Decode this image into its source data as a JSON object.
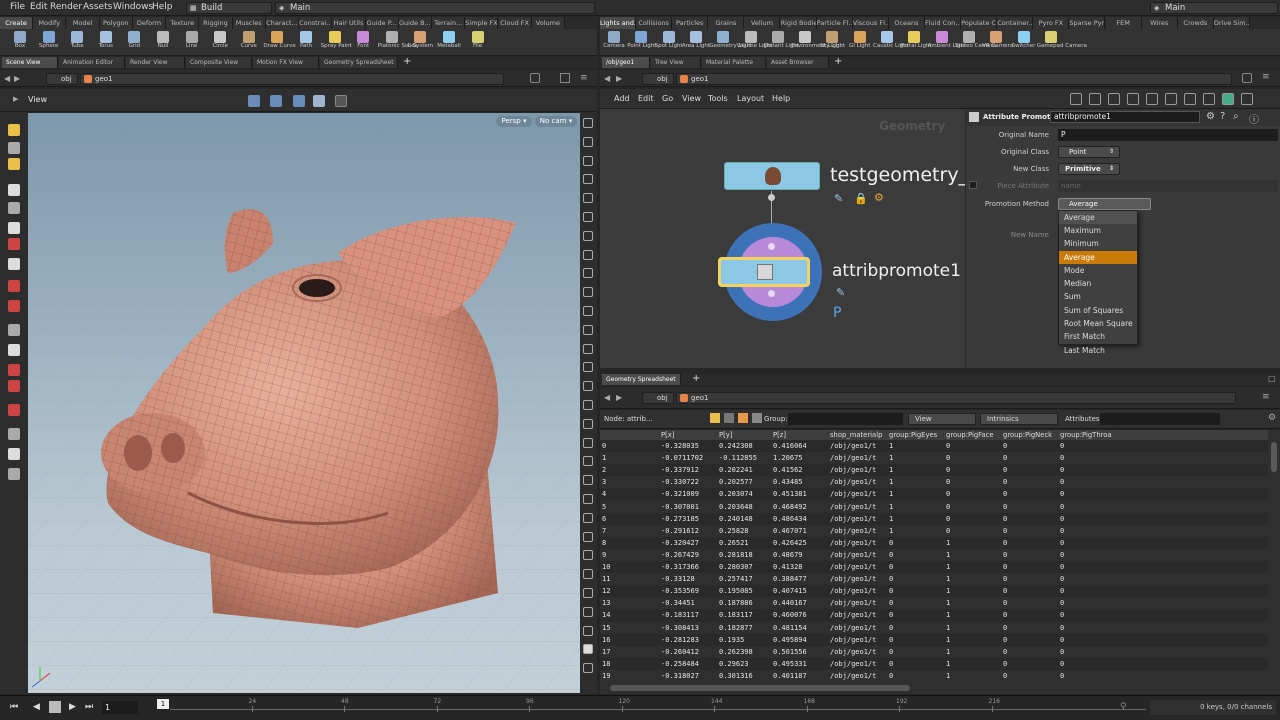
{
  "menubar": {
    "items": [
      "File",
      "Edit",
      "Render",
      "Assets",
      "Windows",
      "Help"
    ],
    "desktop": "Build",
    "scene": "Main",
    "right_desktop": "Main"
  },
  "left_shelf_tabs": [
    "Create",
    "Modify",
    "Model",
    "Polygon",
    "Deform",
    "Texture",
    "Rigging",
    "Muscles",
    "Charact...",
    "Constrai...",
    "Hair Utils",
    "Guide P...",
    "Guide B...",
    "Terrain...",
    "Simple FX",
    "Cloud FX",
    "Volume"
  ],
  "left_tools": [
    "Box",
    "Sphere",
    "Tube",
    "Torus",
    "Grid",
    "Null",
    "Line",
    "Circle",
    "Curve",
    "Draw Curve",
    "Path",
    "Spray Paint",
    "Font",
    "Platonic Solids",
    "L-System",
    "Metaball",
    "File"
  ],
  "right_shelf_tabs": [
    "Lights and...",
    "Collisions",
    "Particles",
    "Grains",
    "Vellum",
    "Rigid Bodies",
    "Particle Fl...",
    "Viscous Fl...",
    "Oceans",
    "Fluid Con...",
    "Populate C...",
    "Container...",
    "Pyro FX",
    "Sparse Pyr...",
    "FEM",
    "Wires",
    "Crowds",
    "Drive Sim..."
  ],
  "right_tools": [
    "Camera",
    "Point Light",
    "Spot Light",
    "Area Light",
    "Geometry Light",
    "Volume Light",
    "Distant Light",
    "Environment Light",
    "Sky Light",
    "GI Light",
    "Caustic Light",
    "Portal Light",
    "Ambient Light",
    "Stereo Camera",
    "VR Camera",
    "Switcher",
    "Gamepad Camera"
  ],
  "left_pane_tabs": [
    "Scene View",
    "Animation Editor",
    "Render View",
    "Composite View",
    "Motion FX View",
    "Geometry Spreadsheet"
  ],
  "viewport": {
    "path_obj": "obj",
    "path_geo": "geo1",
    "view_label": "View",
    "persp": "Persp",
    "cam": "No cam"
  },
  "network": {
    "tabs": [
      "/obj/geo1",
      "Tree View",
      "Material Palette",
      "Asset Browser"
    ],
    "path_obj": "obj",
    "path_geo": "geo1",
    "menu": [
      "Add",
      "Edit",
      "Go",
      "View",
      "Tools",
      "Layout",
      "Help"
    ],
    "context_label": "Geometry",
    "node1_name": "testgeometry_p",
    "node2_name": "attribpromote1",
    "node2_flag": "P"
  },
  "parms": {
    "type": "Attribute Promote",
    "node_name": "attribpromote1",
    "original_name_label": "Original Name",
    "original_name_value": "P",
    "original_class_label": "Original Class",
    "original_class_value": "Point",
    "new_class_label": "New Class",
    "new_class_value": "Primitive",
    "piece_attr_label": "Piece Attribute",
    "piece_attr_value": "name",
    "promo_method_label": "Promotion Method",
    "promo_method_value": "Average",
    "new_name_label": "New Name",
    "menu_options": [
      "Maximum",
      "Minimum",
      "Average",
      "Mode",
      "Median",
      "Sum",
      "Sum of Squares",
      "Root Mean Square",
      "First Match",
      "Last Match"
    ],
    "menu_selected": "Average"
  },
  "spreadsheet": {
    "tab": "Geometry Spreadsheet",
    "path_obj": "obj",
    "path_geo": "geo1",
    "node_label": "Node: attrib...",
    "group_label": "Group:",
    "view_label": "View",
    "intrinsics_label": "Intrinsics",
    "attributes_label": "Attributes:",
    "columns": [
      "",
      "P[x]",
      "P[y]",
      "P[z]",
      "shop_materialp",
      "group:PigEyes",
      "group:PigFace",
      "group:PigNeck",
      "group:PigThroa"
    ],
    "rows": [
      [
        "0",
        "-0.328035",
        "0.242308",
        "0.416064",
        "/obj/geo1/t",
        "1",
        "0",
        "0",
        "0"
      ],
      [
        "1",
        "-0.0711702",
        "-0.112855",
        "1.20675",
        "/obj/geo1/t",
        "1",
        "0",
        "0",
        "0"
      ],
      [
        "2",
        "-0.337912",
        "0.202241",
        "0.41562",
        "/obj/geo1/t",
        "1",
        "0",
        "0",
        "0"
      ],
      [
        "3",
        "-0.330722",
        "0.202577",
        "0.43485",
        "/obj/geo1/t",
        "1",
        "0",
        "0",
        "0"
      ],
      [
        "4",
        "-0.321009",
        "0.203074",
        "0.451381",
        "/obj/geo1/t",
        "1",
        "0",
        "0",
        "0"
      ],
      [
        "5",
        "-0.307001",
        "0.203648",
        "0.468492",
        "/obj/geo1/t",
        "1",
        "0",
        "0",
        "0"
      ],
      [
        "6",
        "-0.273185",
        "0.240148",
        "0.486434",
        "/obj/geo1/t",
        "1",
        "0",
        "0",
        "0"
      ],
      [
        "7",
        "-0.291612",
        "0.25828",
        "0.467071",
        "/obj/geo1/t",
        "1",
        "0",
        "0",
        "0"
      ],
      [
        "8",
        "-0.320427",
        "0.26521",
        "0.426425",
        "/obj/geo1/t",
        "0",
        "1",
        "0",
        "0"
      ],
      [
        "9",
        "-0.267429",
        "0.281818",
        "0.48679",
        "/obj/geo1/t",
        "0",
        "1",
        "0",
        "0"
      ],
      [
        "10",
        "-0.317366",
        "0.280307",
        "0.41328",
        "/obj/geo1/t",
        "0",
        "1",
        "0",
        "0"
      ],
      [
        "11",
        "-0.33128",
        "0.257417",
        "0.388477",
        "/obj/geo1/t",
        "0",
        "1",
        "0",
        "0"
      ],
      [
        "12",
        "-0.353569",
        "0.195085",
        "0.407415",
        "/obj/geo1/t",
        "0",
        "1",
        "0",
        "0"
      ],
      [
        "13",
        "-0.34451",
        "0.187886",
        "0.440167",
        "/obj/geo1/t",
        "0",
        "1",
        "0",
        "0"
      ],
      [
        "14",
        "-0.183117",
        "0.183117",
        "0.460076",
        "/obj/geo1/t",
        "0",
        "1",
        "0",
        "0"
      ],
      [
        "15",
        "-0.308413",
        "0.182877",
        "0.481154",
        "/obj/geo1/t",
        "0",
        "1",
        "0",
        "0"
      ],
      [
        "16",
        "-0.281283",
        "0.1935",
        "0.495894",
        "/obj/geo1/t",
        "0",
        "1",
        "0",
        "0"
      ],
      [
        "17",
        "-0.260412",
        "0.262398",
        "0.501556",
        "/obj/geo1/t",
        "0",
        "1",
        "0",
        "0"
      ],
      [
        "18",
        "-0.258484",
        "0.29623",
        "0.495331",
        "/obj/geo1/t",
        "0",
        "1",
        "0",
        "0"
      ],
      [
        "19",
        "-0.318027",
        "0.301316",
        "0.401187",
        "/obj/geo1/t",
        "0",
        "1",
        "0",
        "0"
      ]
    ]
  },
  "timeline": {
    "frame": "1",
    "current_marker": "1",
    "ticks": [
      "24",
      "48",
      "72",
      "96",
      "120",
      "144",
      "168",
      "192",
      "216"
    ],
    "keys_status": "0 keys, 0/0 channels"
  },
  "colors": {
    "selected_menu": "#c97a07",
    "viewport_top": "#7d98ab",
    "pig_skin": "#d49883",
    "node_selected": "#f2d45c"
  }
}
